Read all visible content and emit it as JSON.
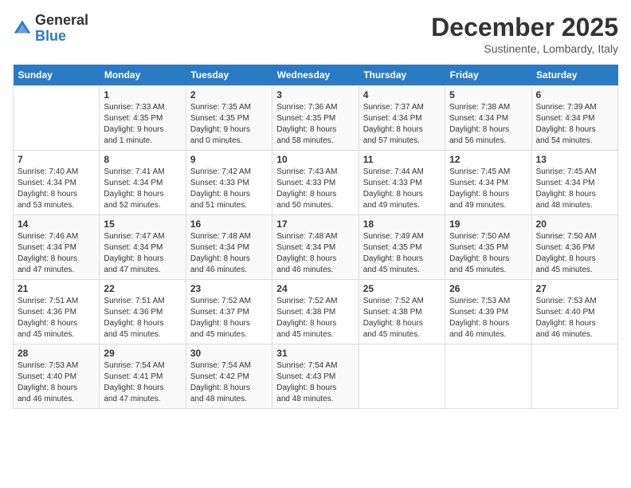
{
  "logo": {
    "general": "General",
    "blue": "Blue"
  },
  "title": "December 2025",
  "subtitle": "Sustinente, Lombardy, Italy",
  "days_header": [
    "Sunday",
    "Monday",
    "Tuesday",
    "Wednesday",
    "Thursday",
    "Friday",
    "Saturday"
  ],
  "weeks": [
    [
      {
        "day": "",
        "info": ""
      },
      {
        "day": "1",
        "info": "Sunrise: 7:33 AM\nSunset: 4:35 PM\nDaylight: 9 hours\nand 1 minute."
      },
      {
        "day": "2",
        "info": "Sunrise: 7:35 AM\nSunset: 4:35 PM\nDaylight: 9 hours\nand 0 minutes."
      },
      {
        "day": "3",
        "info": "Sunrise: 7:36 AM\nSunset: 4:35 PM\nDaylight: 8 hours\nand 58 minutes."
      },
      {
        "day": "4",
        "info": "Sunrise: 7:37 AM\nSunset: 4:34 PM\nDaylight: 8 hours\nand 57 minutes."
      },
      {
        "day": "5",
        "info": "Sunrise: 7:38 AM\nSunset: 4:34 PM\nDaylight: 8 hours\nand 56 minutes."
      },
      {
        "day": "6",
        "info": "Sunrise: 7:39 AM\nSunset: 4:34 PM\nDaylight: 8 hours\nand 54 minutes."
      }
    ],
    [
      {
        "day": "7",
        "info": "Sunrise: 7:40 AM\nSunset: 4:34 PM\nDaylight: 8 hours\nand 53 minutes."
      },
      {
        "day": "8",
        "info": "Sunrise: 7:41 AM\nSunset: 4:34 PM\nDaylight: 8 hours\nand 52 minutes."
      },
      {
        "day": "9",
        "info": "Sunrise: 7:42 AM\nSunset: 4:33 PM\nDaylight: 8 hours\nand 51 minutes."
      },
      {
        "day": "10",
        "info": "Sunrise: 7:43 AM\nSunset: 4:33 PM\nDaylight: 8 hours\nand 50 minutes."
      },
      {
        "day": "11",
        "info": "Sunrise: 7:44 AM\nSunset: 4:33 PM\nDaylight: 8 hours\nand 49 minutes."
      },
      {
        "day": "12",
        "info": "Sunrise: 7:45 AM\nSunset: 4:34 PM\nDaylight: 8 hours\nand 49 minutes."
      },
      {
        "day": "13",
        "info": "Sunrise: 7:45 AM\nSunset: 4:34 PM\nDaylight: 8 hours\nand 48 minutes."
      }
    ],
    [
      {
        "day": "14",
        "info": "Sunrise: 7:46 AM\nSunset: 4:34 PM\nDaylight: 8 hours\nand 47 minutes."
      },
      {
        "day": "15",
        "info": "Sunrise: 7:47 AM\nSunset: 4:34 PM\nDaylight: 8 hours\nand 47 minutes."
      },
      {
        "day": "16",
        "info": "Sunrise: 7:48 AM\nSunset: 4:34 PM\nDaylight: 8 hours\nand 46 minutes."
      },
      {
        "day": "17",
        "info": "Sunrise: 7:48 AM\nSunset: 4:34 PM\nDaylight: 8 hours\nand 46 minutes."
      },
      {
        "day": "18",
        "info": "Sunrise: 7:49 AM\nSunset: 4:35 PM\nDaylight: 8 hours\nand 45 minutes."
      },
      {
        "day": "19",
        "info": "Sunrise: 7:50 AM\nSunset: 4:35 PM\nDaylight: 8 hours\nand 45 minutes."
      },
      {
        "day": "20",
        "info": "Sunrise: 7:50 AM\nSunset: 4:36 PM\nDaylight: 8 hours\nand 45 minutes."
      }
    ],
    [
      {
        "day": "21",
        "info": "Sunrise: 7:51 AM\nSunset: 4:36 PM\nDaylight: 8 hours\nand 45 minutes."
      },
      {
        "day": "22",
        "info": "Sunrise: 7:51 AM\nSunset: 4:36 PM\nDaylight: 8 hours\nand 45 minutes."
      },
      {
        "day": "23",
        "info": "Sunrise: 7:52 AM\nSunset: 4:37 PM\nDaylight: 8 hours\nand 45 minutes."
      },
      {
        "day": "24",
        "info": "Sunrise: 7:52 AM\nSunset: 4:38 PM\nDaylight: 8 hours\nand 45 minutes."
      },
      {
        "day": "25",
        "info": "Sunrise: 7:52 AM\nSunset: 4:38 PM\nDaylight: 8 hours\nand 45 minutes."
      },
      {
        "day": "26",
        "info": "Sunrise: 7:53 AM\nSunset: 4:39 PM\nDaylight: 8 hours\nand 46 minutes."
      },
      {
        "day": "27",
        "info": "Sunrise: 7:53 AM\nSunset: 4:40 PM\nDaylight: 8 hours\nand 46 minutes."
      }
    ],
    [
      {
        "day": "28",
        "info": "Sunrise: 7:53 AM\nSunset: 4:40 PM\nDaylight: 8 hours\nand 46 minutes."
      },
      {
        "day": "29",
        "info": "Sunrise: 7:54 AM\nSunset: 4:41 PM\nDaylight: 8 hours\nand 47 minutes."
      },
      {
        "day": "30",
        "info": "Sunrise: 7:54 AM\nSunset: 4:42 PM\nDaylight: 8 hours\nand 48 minutes."
      },
      {
        "day": "31",
        "info": "Sunrise: 7:54 AM\nSunset: 4:43 PM\nDaylight: 8 hours\nand 48 minutes."
      },
      {
        "day": "",
        "info": ""
      },
      {
        "day": "",
        "info": ""
      },
      {
        "day": "",
        "info": ""
      }
    ]
  ]
}
